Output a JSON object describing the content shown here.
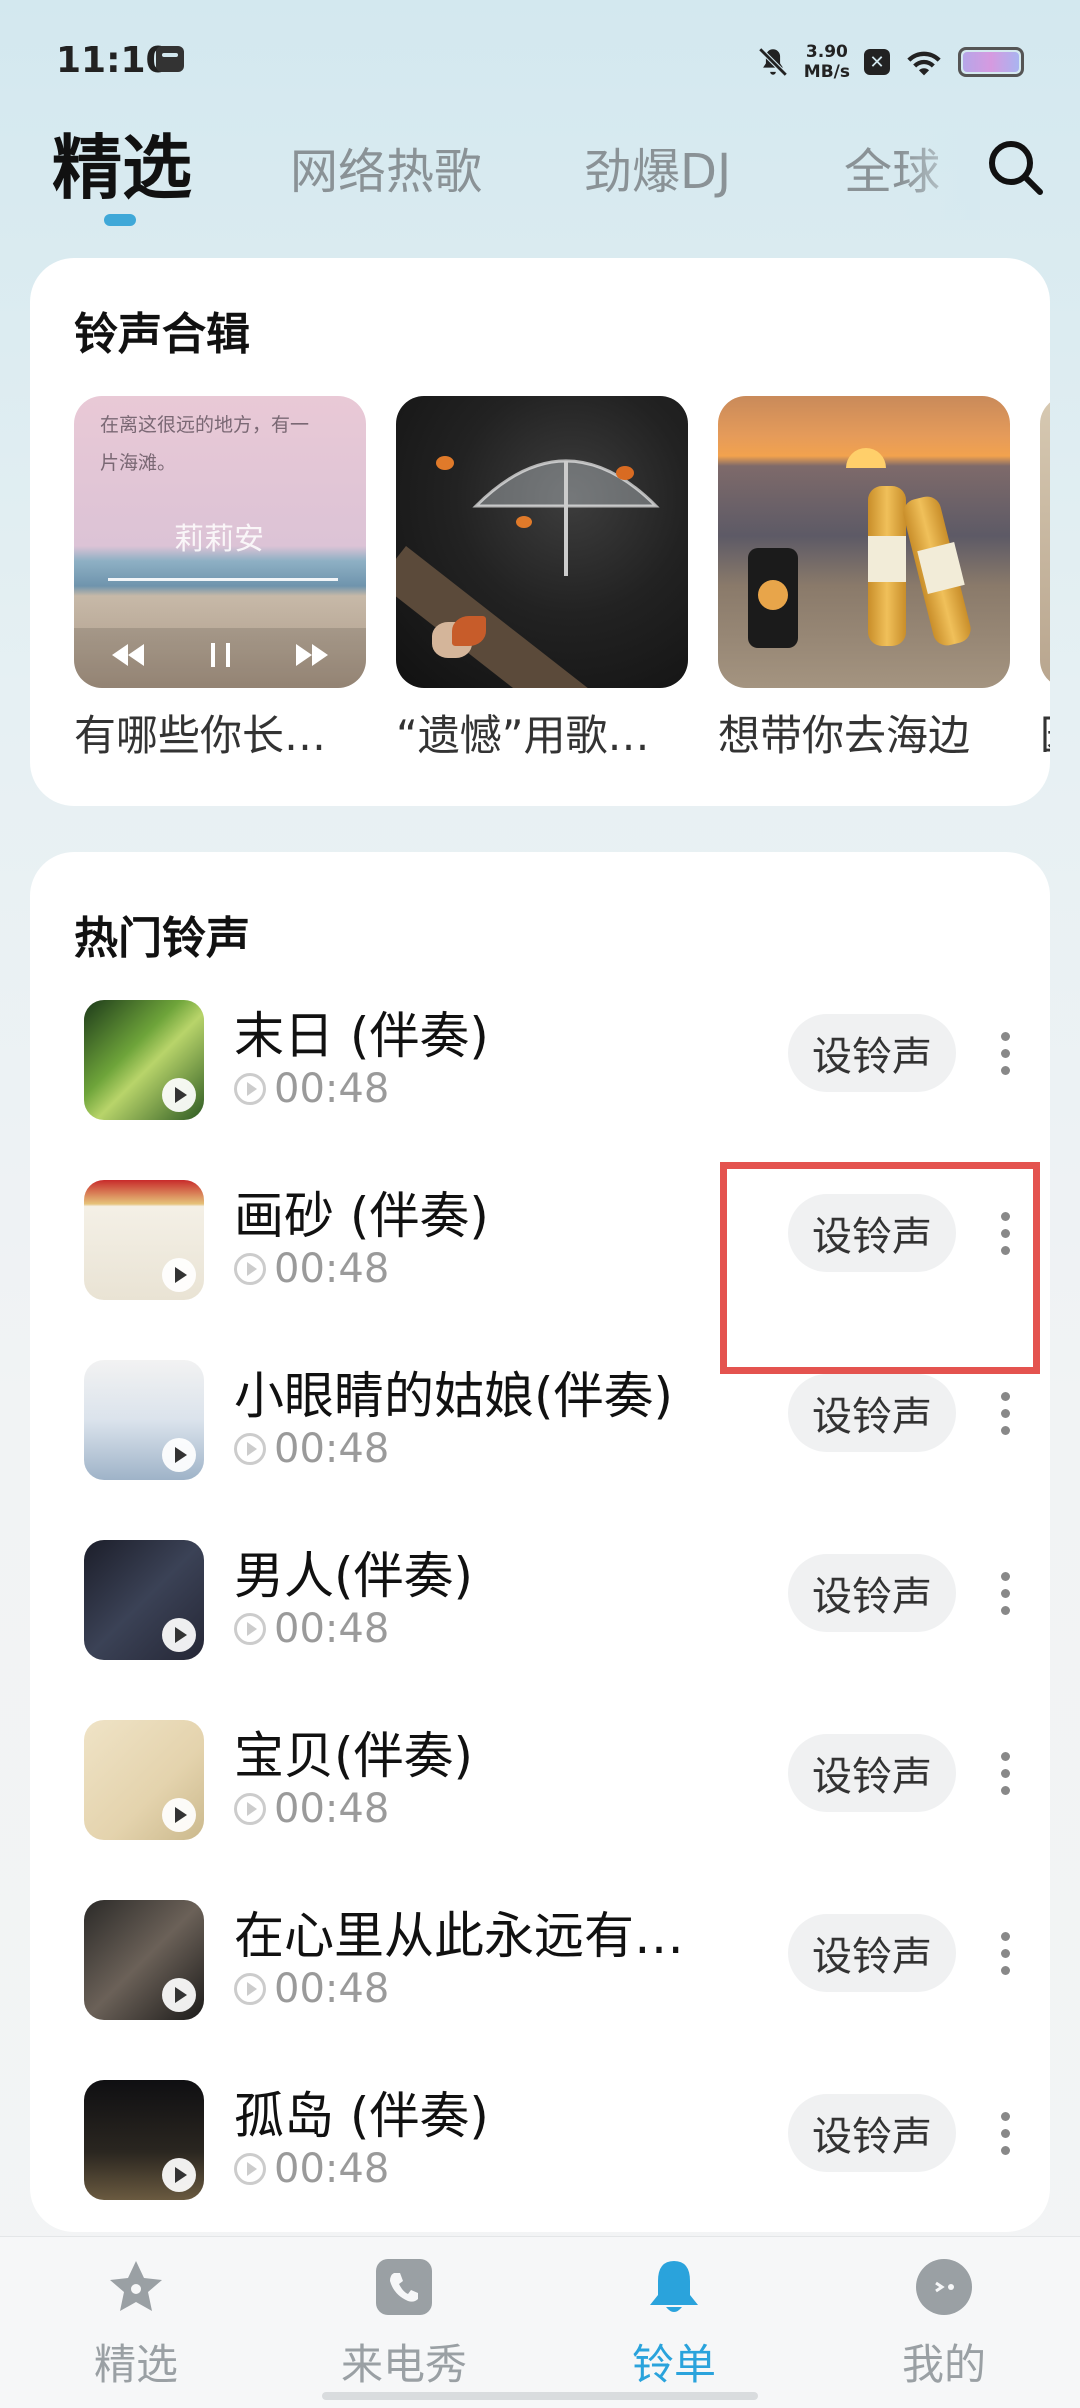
{
  "status_bar": {
    "time": "11:10",
    "speed_value": "3.90",
    "speed_unit": "MB/s",
    "icons": [
      "message-icon",
      "mute-icon",
      "close-box-icon",
      "wifi-icon",
      "battery-icon"
    ]
  },
  "top_tabs": [
    {
      "label": "精选",
      "active": true
    },
    {
      "label": "网络热歌",
      "active": false
    },
    {
      "label": "劲爆DJ",
      "active": false
    },
    {
      "label": "全球",
      "active": false
    }
  ],
  "collections": {
    "title": "铃声合辑",
    "items": [
      {
        "title": "有哪些你长…",
        "cover_text": "在离这很远的地方，有一片海滩。",
        "cover_caption": "莉莉安"
      },
      {
        "title": "“遗憾”用歌…"
      },
      {
        "title": "想带你去海边"
      }
    ]
  },
  "hot": {
    "title": "热门铃声",
    "set_label": "设铃声",
    "songs": [
      {
        "name": "末日 (伴奏)",
        "duration": "00:48"
      },
      {
        "name": "画砂 (伴奏)",
        "duration": "00:48"
      },
      {
        "name": "小眼睛的姑娘(伴奏)",
        "duration": "00:48"
      },
      {
        "name": "男人(伴奏)",
        "duration": "00:48"
      },
      {
        "name": "宝贝(伴奏)",
        "duration": "00:48"
      },
      {
        "name": "在心里从此永远有…",
        "duration": "00:48"
      },
      {
        "name": "孤岛 (伴奏)",
        "duration": "00:48"
      }
    ]
  },
  "bottom_nav": [
    {
      "label": "精选",
      "icon": "star-icon",
      "active": false
    },
    {
      "label": "来电秀",
      "icon": "phone-icon",
      "active": false
    },
    {
      "label": "铃单",
      "icon": "bell-icon",
      "active": true
    },
    {
      "label": "我的",
      "icon": "profile-face-icon",
      "active": false
    }
  ],
  "colors": {
    "accent": "#2aa3dc",
    "highlight": "#e4534f"
  }
}
